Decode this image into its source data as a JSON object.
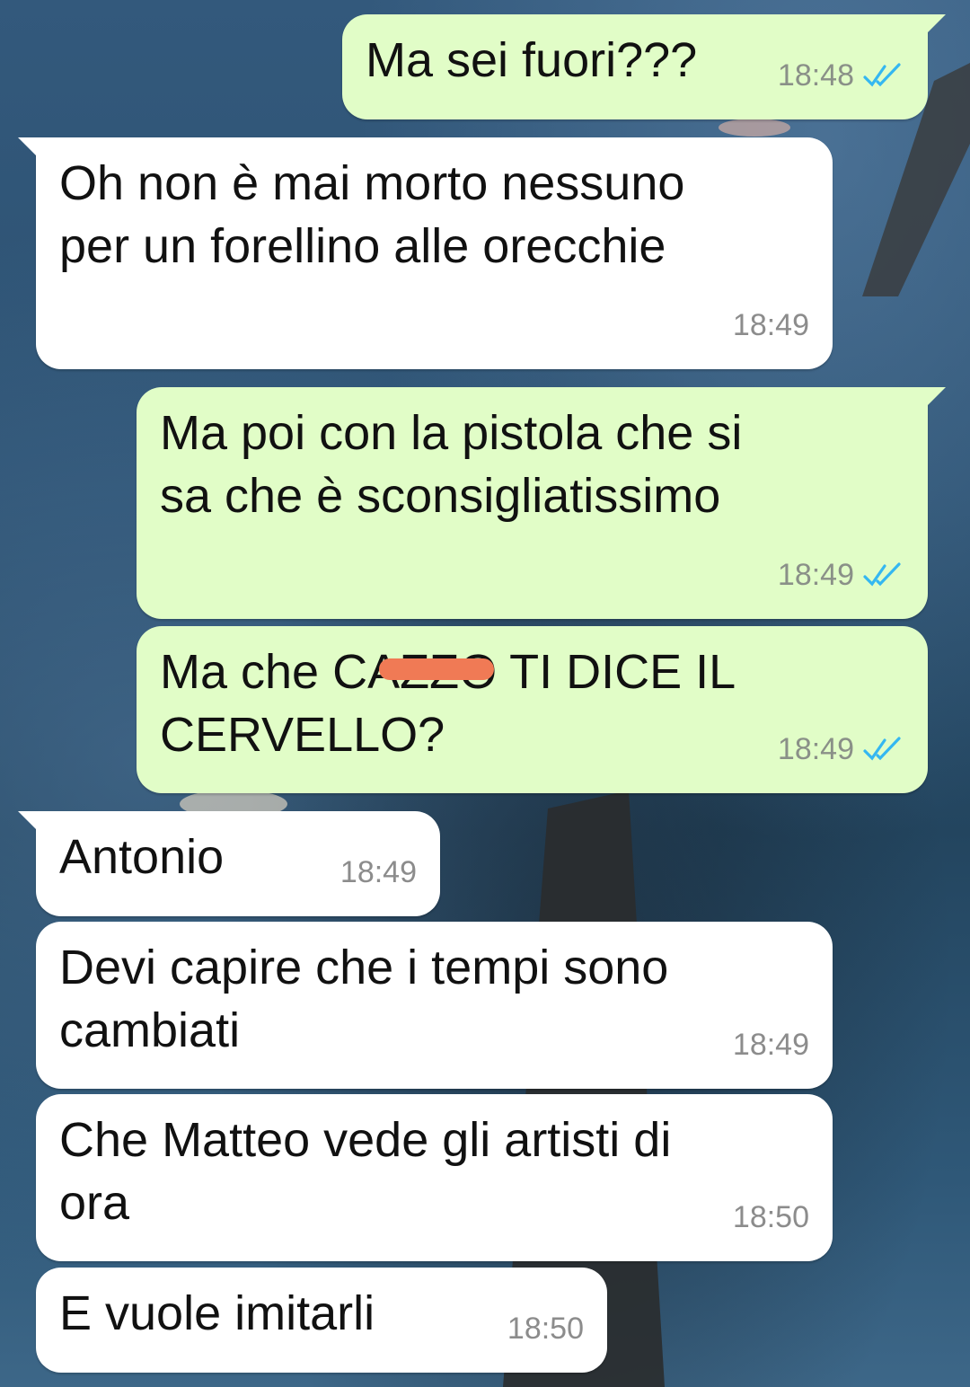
{
  "colors": {
    "outgoing_bubble": "#e1fdc7",
    "incoming_bubble": "#ffffff",
    "read_ticks": "#34b7f1",
    "redaction": "#f07a55"
  },
  "messages": [
    {
      "direction": "outgoing",
      "text": "Ma sei fuori???",
      "time": "18:48",
      "status": "read"
    },
    {
      "direction": "incoming",
      "text": "Oh non è mai morto nessuno\nper un forellino alle orecchie",
      "time": "18:49"
    },
    {
      "direction": "outgoing",
      "text": "Ma poi con la pistola che si\nsa che è sconsigliatissimo",
      "time": "18:49",
      "status": "read"
    },
    {
      "direction": "outgoing",
      "text": "Ma che CAZZO TI DICE IL\nCERVELLO?",
      "time": "18:49",
      "status": "read",
      "redacted": true
    },
    {
      "direction": "incoming",
      "text": "Antonio",
      "time": "18:49"
    },
    {
      "direction": "incoming",
      "text": "Devi capire che i tempi sono\ncambiati",
      "time": "18:49"
    },
    {
      "direction": "incoming",
      "text": "Che Matteo vede gli artisti di\nora",
      "time": "18:50"
    },
    {
      "direction": "incoming",
      "text": "E vuole imitarli",
      "time": "18:50"
    }
  ]
}
